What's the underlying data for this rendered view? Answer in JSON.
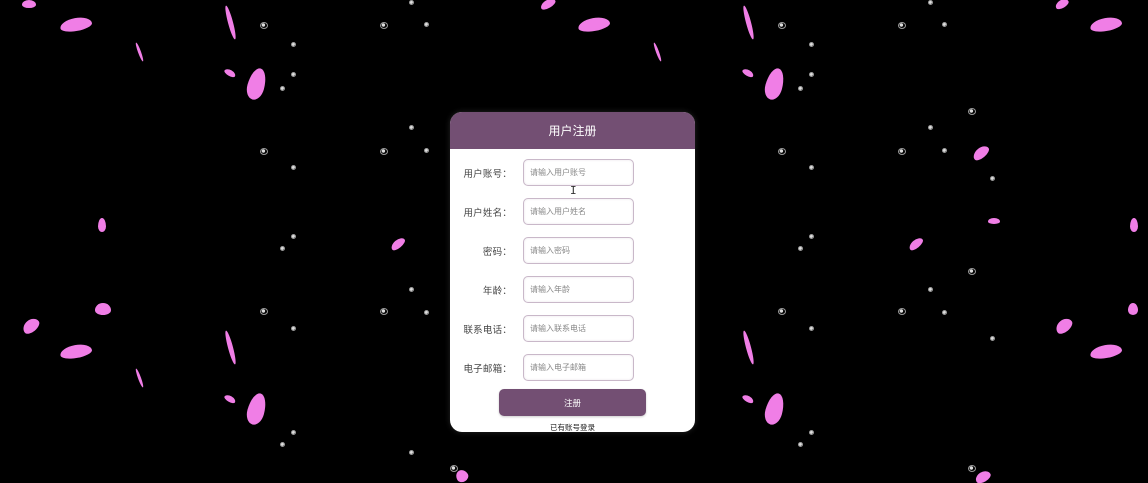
{
  "form": {
    "title": "用户注册",
    "fields": [
      {
        "label": "用户账号：",
        "placeholder": "请输入用户账号",
        "value": ""
      },
      {
        "label": "用户姓名：",
        "placeholder": "请输入用户姓名",
        "value": ""
      },
      {
        "label": "密码：",
        "placeholder": "请输入密码",
        "value": ""
      },
      {
        "label": "年龄：",
        "placeholder": "请输入年龄",
        "value": ""
      },
      {
        "label": "联系电话：",
        "placeholder": "请输入联系电话",
        "value": ""
      },
      {
        "label": "电子邮箱：",
        "placeholder": "请输入电子邮箱",
        "value": ""
      }
    ],
    "submit_label": "注册",
    "login_link": "已有账号登录"
  },
  "colors": {
    "background": "#000000",
    "accent": "#734f73",
    "petal": "#f07ee6"
  },
  "icons": {
    "cursor": "text-cursor-icon"
  }
}
